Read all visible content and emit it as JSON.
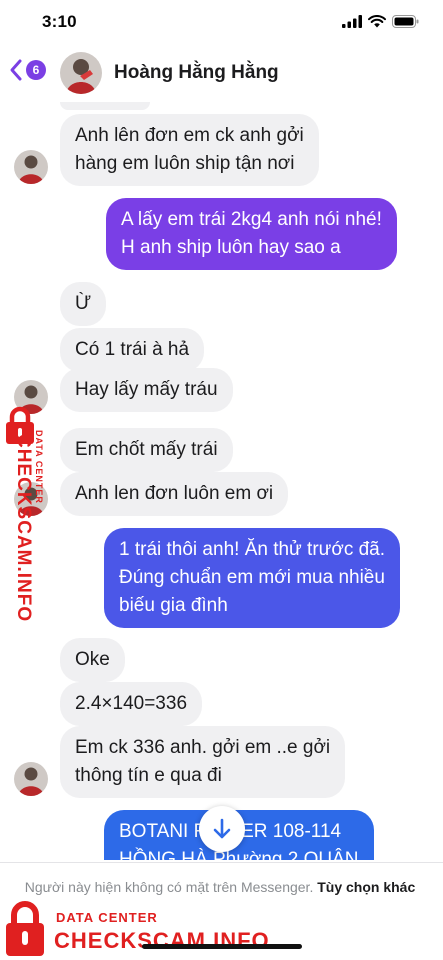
{
  "status_bar": {
    "time": "3:10"
  },
  "header": {
    "back_count": "6",
    "contact_name": "Hoàng Hằng Hằng"
  },
  "messages": [
    {
      "from": "contact",
      "text": "Anh lên đơn em ck anh gởi\nhàng em luôn ship tận nơi"
    },
    {
      "from": "me",
      "text": "A lấy em trái 2kg4 anh nói nhé!\nH anh ship luôn hay sao a"
    },
    {
      "from": "contact",
      "text": "Ừ"
    },
    {
      "from": "contact",
      "text": "Có 1 trái à hả"
    },
    {
      "from": "contact",
      "text": "Hay lấy mấy tráu"
    },
    {
      "from": "contact",
      "text": "Em chốt mấy trái"
    },
    {
      "from": "contact",
      "text": "Anh len đơn luôn em ơi"
    },
    {
      "from": "me",
      "text": "1 trái thôi anh! Ăn thử trước đã.\nĐúng chuẩn em mới mua nhiều\nbiếu gia đình"
    },
    {
      "from": "contact",
      "text": "Oke"
    },
    {
      "from": "contact",
      "text": "2.4×140=336"
    },
    {
      "from": "contact",
      "text": "Em ck 336 anh. gởi em ..e gởi\nthông tín e qua đi"
    },
    {
      "from": "me",
      "text": "BOTANI      REMIER 108-114\nHỒNG HÀ  Phường 2  QUẬN"
    }
  ],
  "footer": {
    "notice": "Người này hiện không có mặt trên Messenger.",
    "link": "Tùy chọn khác"
  },
  "watermark": {
    "title": "CHECKSCAM.INFO",
    "subtitle": "DATA CENTER"
  },
  "colors": {
    "outgoing_purple": "#7a3fe6",
    "outgoing_blue": "#4b57e8",
    "outgoing_bluer": "#2d6ae8",
    "incoming_gray": "#f0f0f2",
    "accent": "#7b3fe4",
    "watermark_red": "#e02020"
  },
  "icons": [
    "back-chevron-icon",
    "signal-icon",
    "wifi-icon",
    "battery-icon",
    "arrow-down-icon",
    "lock-icon"
  ]
}
